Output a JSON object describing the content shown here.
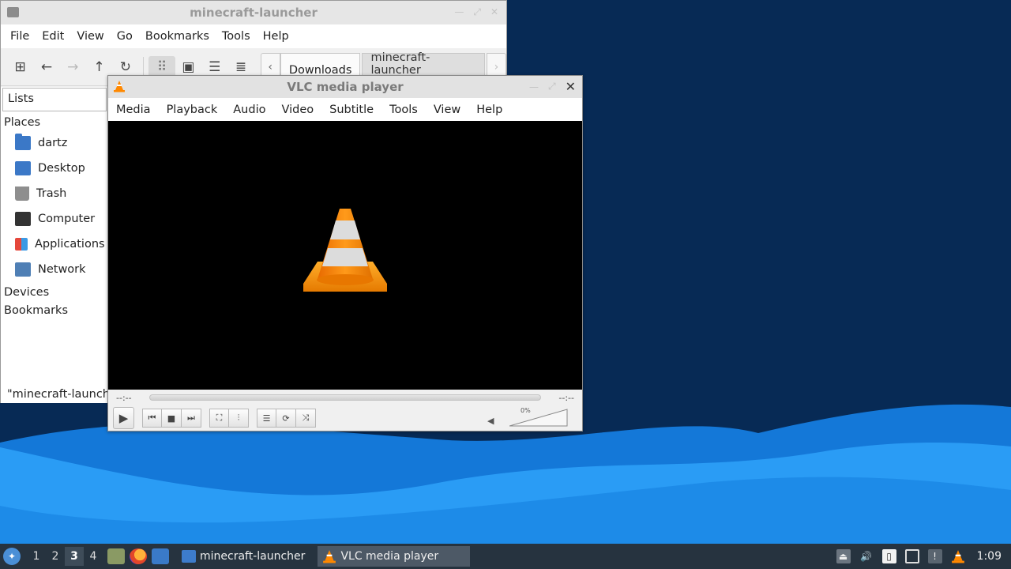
{
  "file_manager": {
    "title": "minecraft-launcher",
    "menu": [
      "File",
      "Edit",
      "View",
      "Go",
      "Bookmarks",
      "Tools",
      "Help"
    ],
    "breadcrumb": [
      "Downloads",
      "minecraft-launcher"
    ],
    "sidebar": {
      "selector": "Lists",
      "places_header": "Places",
      "places": [
        {
          "label": "dartz",
          "icon": "home-folder-icon"
        },
        {
          "label": "Desktop",
          "icon": "desktop-icon"
        },
        {
          "label": "Trash",
          "icon": "trash-icon"
        },
        {
          "label": "Computer",
          "icon": "computer-icon"
        },
        {
          "label": "Applications",
          "icon": "applications-icon"
        },
        {
          "label": "Network",
          "icon": "network-icon"
        }
      ],
      "devices_header": "Devices",
      "bookmarks_header": "Bookmarks"
    },
    "status": "\"minecraft-launcher\""
  },
  "vlc": {
    "title": "VLC media player",
    "menu": [
      "Media",
      "Playback",
      "Audio",
      "Video",
      "Subtitle",
      "Tools",
      "View",
      "Help"
    ],
    "time_elapsed": "--:--",
    "time_total": "--:--",
    "volume_label": "0%",
    "volume": 0
  },
  "taskbar": {
    "workspaces": [
      "1",
      "2",
      "3",
      "4"
    ],
    "active_workspace": "3",
    "tasks": [
      {
        "label": "minecraft-launcher",
        "icon": "folder-icon"
      },
      {
        "label": "VLC media player",
        "icon": "vlc-cone-icon"
      }
    ],
    "clock": "1:09"
  },
  "colors": {
    "desktop_bg": "#072a55",
    "wave_light": "#1e8cf0",
    "taskbar_bg": "#26333f",
    "vlc_orange": "#ff8800"
  }
}
